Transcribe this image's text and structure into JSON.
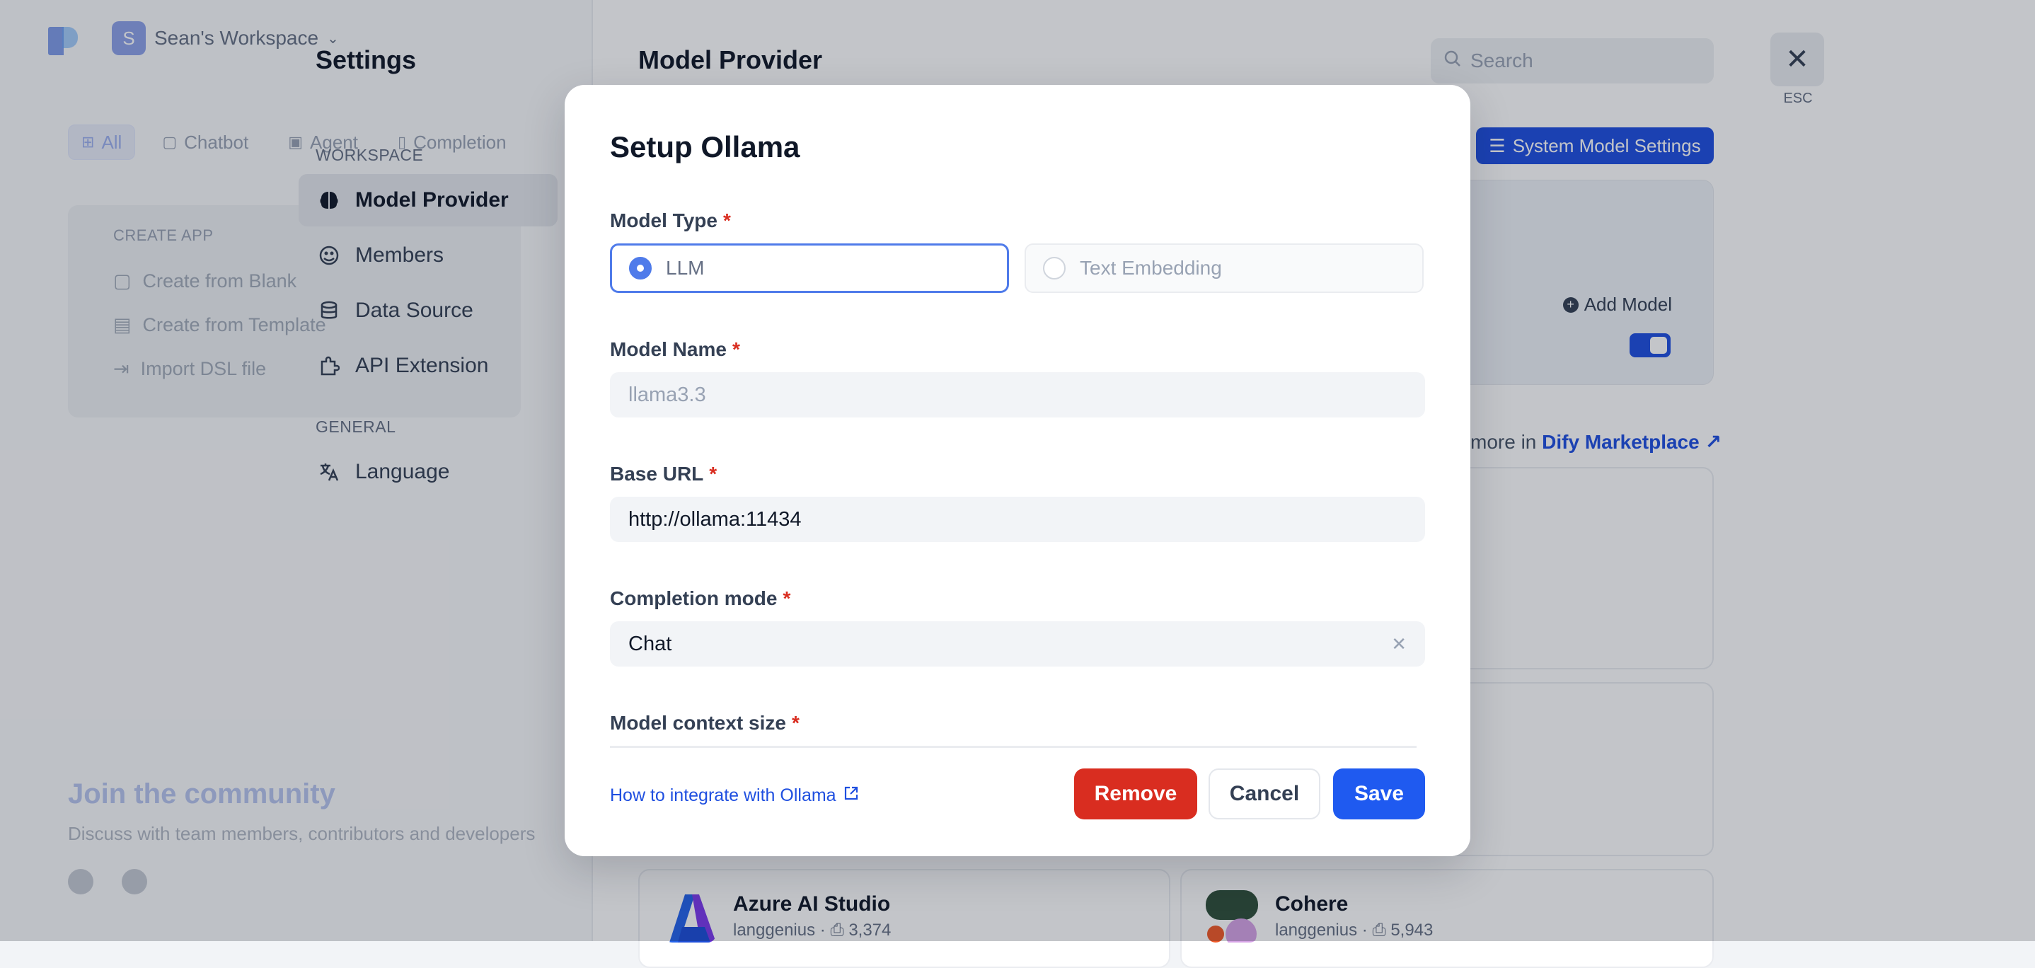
{
  "apps_page": {
    "workspace_avatar": "S",
    "workspace_name": "Sean's Workspace",
    "tabs": [
      {
        "label": "All",
        "icon": "grid-icon"
      },
      {
        "label": "Chatbot",
        "icon": "chat-icon"
      },
      {
        "label": "Agent",
        "icon": "robot-icon"
      },
      {
        "label": "Completion",
        "icon": "document-icon"
      }
    ],
    "create_app": {
      "title": "CREATE APP",
      "items": [
        "Create from Blank",
        "Create from Template",
        "Import DSL file"
      ]
    },
    "community": {
      "title": "Join the community",
      "subtitle": "Discuss with team members, contributors and developers"
    }
  },
  "settings": {
    "title": "Settings",
    "workspace_label": "WORKSPACE",
    "general_label": "GENERAL",
    "nav": [
      {
        "label": "Model Provider",
        "icon": "brain-icon",
        "active": true
      },
      {
        "label": "Members",
        "icon": "members-icon",
        "active": false
      },
      {
        "label": "Data Source",
        "icon": "database-icon",
        "active": false
      },
      {
        "label": "API Extension",
        "icon": "puzzle-icon",
        "active": false
      }
    ],
    "general_nav": [
      {
        "label": "Language",
        "icon": "translate-icon"
      }
    ]
  },
  "model_provider": {
    "title": "Model Provider",
    "search_placeholder": "Search",
    "esc_label": "ESC",
    "system_model_settings": "System Model Settings",
    "add_model": "Add Model",
    "marketplace_prefix": "more in",
    "marketplace_link": "Dify Marketplace",
    "providers": [
      {
        "name": "Azure AI Studio",
        "author": "langgenius",
        "installs": "3,374"
      },
      {
        "name": "Cohere",
        "author": "langgenius",
        "installs": "5,943"
      }
    ]
  },
  "modal": {
    "title": "Setup Ollama",
    "model_type_label": "Model Type",
    "model_type_options": [
      {
        "label": "LLM",
        "selected": true
      },
      {
        "label": "Text Embedding",
        "selected": false
      }
    ],
    "model_name_label": "Model Name",
    "model_name_placeholder": "llama3.3",
    "base_url_label": "Base URL",
    "base_url_value": "http://ollama:11434",
    "completion_mode_label": "Completion mode",
    "completion_mode_value": "Chat",
    "context_size_label": "Model context size",
    "required_mark": "*",
    "help_link": "How to integrate with Ollama",
    "buttons": {
      "remove": "Remove",
      "cancel": "Cancel",
      "save": "Save"
    }
  },
  "colors": {
    "primary": "#1f5af0",
    "danger": "#d92d20"
  }
}
